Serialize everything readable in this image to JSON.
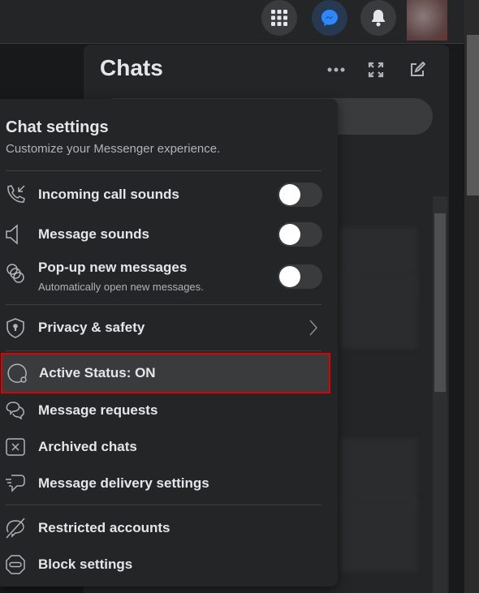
{
  "header": {
    "icons": [
      "apps-grid-icon",
      "messenger-icon",
      "notifications-bell-icon"
    ],
    "messenger_active_color": "#2d88ff"
  },
  "chats": {
    "title": "Chats",
    "actions": [
      "more-options-icon",
      "expand-icon",
      "new-message-icon"
    ]
  },
  "menu": {
    "title": "Chat settings",
    "subtitle": "Customize your Messenger experience.",
    "items": [
      {
        "label": "Incoming call sounds",
        "icon": "incoming-call-icon",
        "toggle": false
      },
      {
        "label": "Message sounds",
        "icon": "speaker-icon",
        "toggle": false
      },
      {
        "label": "Pop-up new messages",
        "sublabel": "Automatically open new messages.",
        "icon": "popup-bubbles-icon",
        "toggle": false
      },
      {
        "label": "Privacy & safety",
        "icon": "shield-icon"
      },
      {
        "label": "Active Status: ON",
        "icon": "active-status-icon",
        "highlighted": true
      },
      {
        "label": "Message requests",
        "icon": "message-requests-icon"
      },
      {
        "label": "Archived chats",
        "icon": "archive-icon"
      },
      {
        "label": "Message delivery settings",
        "icon": "message-delivery-icon"
      },
      {
        "label": "Restricted accounts",
        "icon": "restricted-icon"
      },
      {
        "label": "Block settings",
        "icon": "block-icon"
      }
    ],
    "highlight_color": "#e00000"
  }
}
